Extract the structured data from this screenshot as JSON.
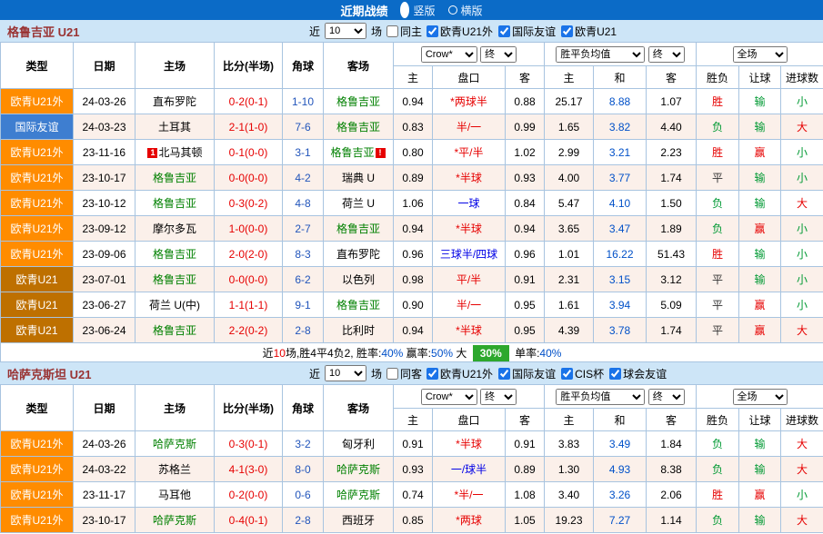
{
  "topbar": {
    "title": "近期战绩",
    "vertical": "竖版",
    "horizontal": "横版"
  },
  "labels": {
    "near": "近",
    "games": "场"
  },
  "colors": {
    "topbar_bg": "#0B6BC7",
    "section_bg": "#CDE5F7",
    "grid_border": "#A8C4E0",
    "type_ext": "#FF8C00",
    "type_friendly": "#3E7ED0",
    "type_u21": "#BE7000",
    "focus_team": "#008000",
    "score": "#E60000",
    "corner": "#2255BB",
    "handicap_red": "#E60000",
    "handicap_blue": "#0000E6",
    "avg_draw": "#0050C8",
    "win": "#E60000",
    "lose": "#009933",
    "big": "#E60000",
    "small": "#009933",
    "highlight_green_bg": "#2DA82D"
  },
  "hdr": {
    "type": "类型",
    "date": "日期",
    "home": "主场",
    "score": "比分(半场)",
    "corner": "角球",
    "away": "客场",
    "company": "Crow*",
    "final": "终",
    "avg": "胜平负均值",
    "final2": "终",
    "scope": "全场",
    "sub": [
      "主",
      "盘口",
      "客",
      "主",
      "和",
      "客",
      "胜负",
      "让球",
      "进球数"
    ]
  },
  "sections": [
    {
      "title": "格鲁吉亚 U21",
      "filter": {
        "count": "10",
        "same": "同主",
        "same_checked": false,
        "leagues": [
          {
            "label": "欧青U21外",
            "checked": true
          },
          {
            "label": "国际友谊",
            "checked": true
          },
          {
            "label": "欧青U21",
            "checked": true
          }
        ]
      },
      "rows": [
        {
          "type": "欧青U21外",
          "type_style": "ext",
          "date": "24-03-26",
          "home": "直布罗陀",
          "home_green": false,
          "home_badge": "",
          "score": "0-2(0-1)",
          "corner": "1-10",
          "away": "格鲁吉亚",
          "away_green": true,
          "away_badge": "",
          "o1": "0.94",
          "handicap": "*两球半",
          "h_style": "red",
          "o2": "0.88",
          "m1": "25.17",
          "m2": "8.88",
          "m3": "1.07",
          "res": "胜",
          "res_style": "win",
          "hres": "输",
          "hres_style": "lose",
          "goal": "小",
          "goal_style": "small"
        },
        {
          "type": "国际友谊",
          "type_style": "friendly",
          "date": "24-03-23",
          "home": "土耳其",
          "home_green": false,
          "home_badge": "",
          "score": "2-1(1-0)",
          "corner": "7-6",
          "away": "格鲁吉亚",
          "away_green": true,
          "away_badge": "",
          "o1": "0.83",
          "handicap": "半/一",
          "h_style": "red",
          "o2": "0.99",
          "m1": "1.65",
          "m2": "3.82",
          "m3": "4.40",
          "res": "负",
          "res_style": "lose",
          "hres": "输",
          "hres_style": "lose",
          "goal": "大",
          "goal_style": "big"
        },
        {
          "type": "欧青U21外",
          "type_style": "ext",
          "date": "23-11-16",
          "home": "北马其顿",
          "home_green": false,
          "home_badge": "1",
          "score": "0-1(0-0)",
          "corner": "3-1",
          "away": "格鲁吉亚",
          "away_green": true,
          "away_badge": "!",
          "o1": "0.80",
          "handicap": "*平/半",
          "h_style": "red",
          "o2": "1.02",
          "m1": "2.99",
          "m2": "3.21",
          "m3": "2.23",
          "res": "胜",
          "res_style": "win",
          "hres": "赢",
          "hres_style": "win",
          "goal": "小",
          "goal_style": "small"
        },
        {
          "type": "欧青U21外",
          "type_style": "ext",
          "date": "23-10-17",
          "home": "格鲁吉亚",
          "home_green": true,
          "home_badge": "",
          "score": "0-0(0-0)",
          "corner": "4-2",
          "away": "瑞典 U",
          "away_green": false,
          "away_badge": "",
          "o1": "0.89",
          "handicap": "*半球",
          "h_style": "red",
          "o2": "0.93",
          "m1": "4.00",
          "m2": "3.77",
          "m3": "1.74",
          "res": "平",
          "res_style": "draw",
          "hres": "输",
          "hres_style": "lose",
          "goal": "小",
          "goal_style": "small"
        },
        {
          "type": "欧青U21外",
          "type_style": "ext",
          "date": "23-10-12",
          "home": "格鲁吉亚",
          "home_green": true,
          "home_badge": "",
          "score": "0-3(0-2)",
          "corner": "4-8",
          "away": "荷兰 U",
          "away_green": false,
          "away_badge": "",
          "o1": "1.06",
          "handicap": "一球",
          "h_style": "blue",
          "o2": "0.84",
          "m1": "5.47",
          "m2": "4.10",
          "m3": "1.50",
          "res": "负",
          "res_style": "lose",
          "hres": "输",
          "hres_style": "lose",
          "goal": "大",
          "goal_style": "big"
        },
        {
          "type": "欧青U21外",
          "type_style": "ext",
          "date": "23-09-12",
          "home": "摩尔多瓦",
          "home_green": false,
          "home_badge": "",
          "score": "1-0(0-0)",
          "corner": "2-7",
          "away": "格鲁吉亚",
          "away_green": true,
          "away_badge": "",
          "o1": "0.94",
          "handicap": "*半球",
          "h_style": "red",
          "o2": "0.94",
          "m1": "3.65",
          "m2": "3.47",
          "m3": "1.89",
          "res": "负",
          "res_style": "lose",
          "hres": "赢",
          "hres_style": "win",
          "goal": "小",
          "goal_style": "small"
        },
        {
          "type": "欧青U21外",
          "type_style": "ext",
          "date": "23-09-06",
          "home": "格鲁吉亚",
          "home_green": true,
          "home_badge": "",
          "score": "2-0(2-0)",
          "corner": "8-3",
          "away": "直布罗陀",
          "away_green": false,
          "away_badge": "",
          "o1": "0.96",
          "handicap": "三球半/四球",
          "h_style": "blue",
          "o2": "0.96",
          "m1": "1.01",
          "m2": "16.22",
          "m3": "51.43",
          "res": "胜",
          "res_style": "win",
          "hres": "输",
          "hres_style": "lose",
          "goal": "小",
          "goal_style": "small"
        },
        {
          "type": "欧青U21",
          "type_style": "u21",
          "date": "23-07-01",
          "home": "格鲁吉亚",
          "home_green": true,
          "home_badge": "",
          "score": "0-0(0-0)",
          "corner": "6-2",
          "away": "以色列",
          "away_green": false,
          "away_badge": "",
          "o1": "0.98",
          "handicap": "平/半",
          "h_style": "red",
          "o2": "0.91",
          "m1": "2.31",
          "m2": "3.15",
          "m3": "3.12",
          "res": "平",
          "res_style": "draw",
          "hres": "输",
          "hres_style": "lose",
          "goal": "小",
          "goal_style": "small"
        },
        {
          "type": "欧青U21",
          "type_style": "u21",
          "date": "23-06-27",
          "home": "荷兰 U(中)",
          "home_green": false,
          "home_badge": "",
          "score": "1-1(1-1)",
          "corner": "9-1",
          "away": "格鲁吉亚",
          "away_green": true,
          "away_badge": "",
          "o1": "0.90",
          "handicap": "半/一",
          "h_style": "red",
          "o2": "0.95",
          "m1": "1.61",
          "m2": "3.94",
          "m3": "5.09",
          "res": "平",
          "res_style": "draw",
          "hres": "赢",
          "hres_style": "win",
          "goal": "小",
          "goal_style": "small"
        },
        {
          "type": "欧青U21",
          "type_style": "u21",
          "date": "23-06-24",
          "home": "格鲁吉亚",
          "home_green": true,
          "home_badge": "",
          "score": "2-2(0-2)",
          "corner": "2-8",
          "away": "比利时",
          "away_green": false,
          "away_badge": "",
          "o1": "0.94",
          "handicap": "*半球",
          "h_style": "red",
          "o2": "0.95",
          "m1": "4.39",
          "m2": "3.78",
          "m3": "1.74",
          "res": "平",
          "res_style": "draw",
          "hres": "赢",
          "hres_style": "win",
          "goal": "大",
          "goal_style": "big"
        }
      ],
      "summary": [
        {
          "text": "近",
          "style": "plain"
        },
        {
          "text": "10",
          "style": "red"
        },
        {
          "text": "场,胜4平4负2, 胜率:",
          "style": "plain"
        },
        {
          "text": "40%",
          "style": "blue"
        },
        {
          "text": " 赢率:",
          "style": "plain"
        },
        {
          "text": "50%",
          "style": "blue"
        },
        {
          "text": " 大 ",
          "style": "plain"
        },
        {
          "text": "30%",
          "style": "greenbox"
        },
        {
          "text": " 单率:",
          "style": "plain"
        },
        {
          "text": "40%",
          "style": "blue"
        }
      ]
    },
    {
      "title": "哈萨克斯坦 U21",
      "filter": {
        "count": "10",
        "same": "同客",
        "same_checked": false,
        "leagues": [
          {
            "label": "欧青U21外",
            "checked": true
          },
          {
            "label": "国际友谊",
            "checked": true
          },
          {
            "label": "CIS杯",
            "checked": true
          },
          {
            "label": "球会友谊",
            "checked": true
          }
        ]
      },
      "rows": [
        {
          "type": "欧青U21外",
          "type_style": "ext",
          "date": "24-03-26",
          "home": "哈萨克斯",
          "home_green": true,
          "home_badge": "",
          "score": "0-3(0-1)",
          "corner": "3-2",
          "away": "匈牙利",
          "away_green": false,
          "away_badge": "",
          "o1": "0.91",
          "handicap": "*半球",
          "h_style": "red",
          "o2": "0.91",
          "m1": "3.83",
          "m2": "3.49",
          "m3": "1.84",
          "res": "负",
          "res_style": "lose",
          "hres": "输",
          "hres_style": "lose",
          "goal": "大",
          "goal_style": "big"
        },
        {
          "type": "欧青U21外",
          "type_style": "ext",
          "date": "24-03-22",
          "home": "苏格兰",
          "home_green": false,
          "home_badge": "",
          "score": "4-1(3-0)",
          "corner": "8-0",
          "away": "哈萨克斯",
          "away_green": true,
          "away_badge": "",
          "o1": "0.93",
          "handicap": "一/球半",
          "h_style": "blue",
          "o2": "0.89",
          "m1": "1.30",
          "m2": "4.93",
          "m3": "8.38",
          "res": "负",
          "res_style": "lose",
          "hres": "输",
          "hres_style": "lose",
          "goal": "大",
          "goal_style": "big"
        },
        {
          "type": "欧青U21外",
          "type_style": "ext",
          "date": "23-11-17",
          "home": "马耳他",
          "home_green": false,
          "home_badge": "",
          "score": "0-2(0-0)",
          "corner": "0-6",
          "away": "哈萨克斯",
          "away_green": true,
          "away_badge": "",
          "o1": "0.74",
          "handicap": "*半/一",
          "h_style": "red",
          "o2": "1.08",
          "m1": "3.40",
          "m2": "3.26",
          "m3": "2.06",
          "res": "胜",
          "res_style": "win",
          "hres": "赢",
          "hres_style": "win",
          "goal": "小",
          "goal_style": "small"
        },
        {
          "type": "欧青U21外",
          "type_style": "ext",
          "date": "23-10-17",
          "home": "哈萨克斯",
          "home_green": true,
          "home_badge": "",
          "score": "0-4(0-1)",
          "corner": "2-8",
          "away": "西班牙",
          "away_green": false,
          "away_badge": "",
          "o1": "0.85",
          "handicap": "*两球",
          "h_style": "red",
          "o2": "1.05",
          "m1": "19.23",
          "m2": "7.27",
          "m3": "1.14",
          "res": "负",
          "res_style": "lose",
          "hres": "输",
          "hres_style": "lose",
          "goal": "大",
          "goal_style": "big"
        }
      ]
    }
  ]
}
